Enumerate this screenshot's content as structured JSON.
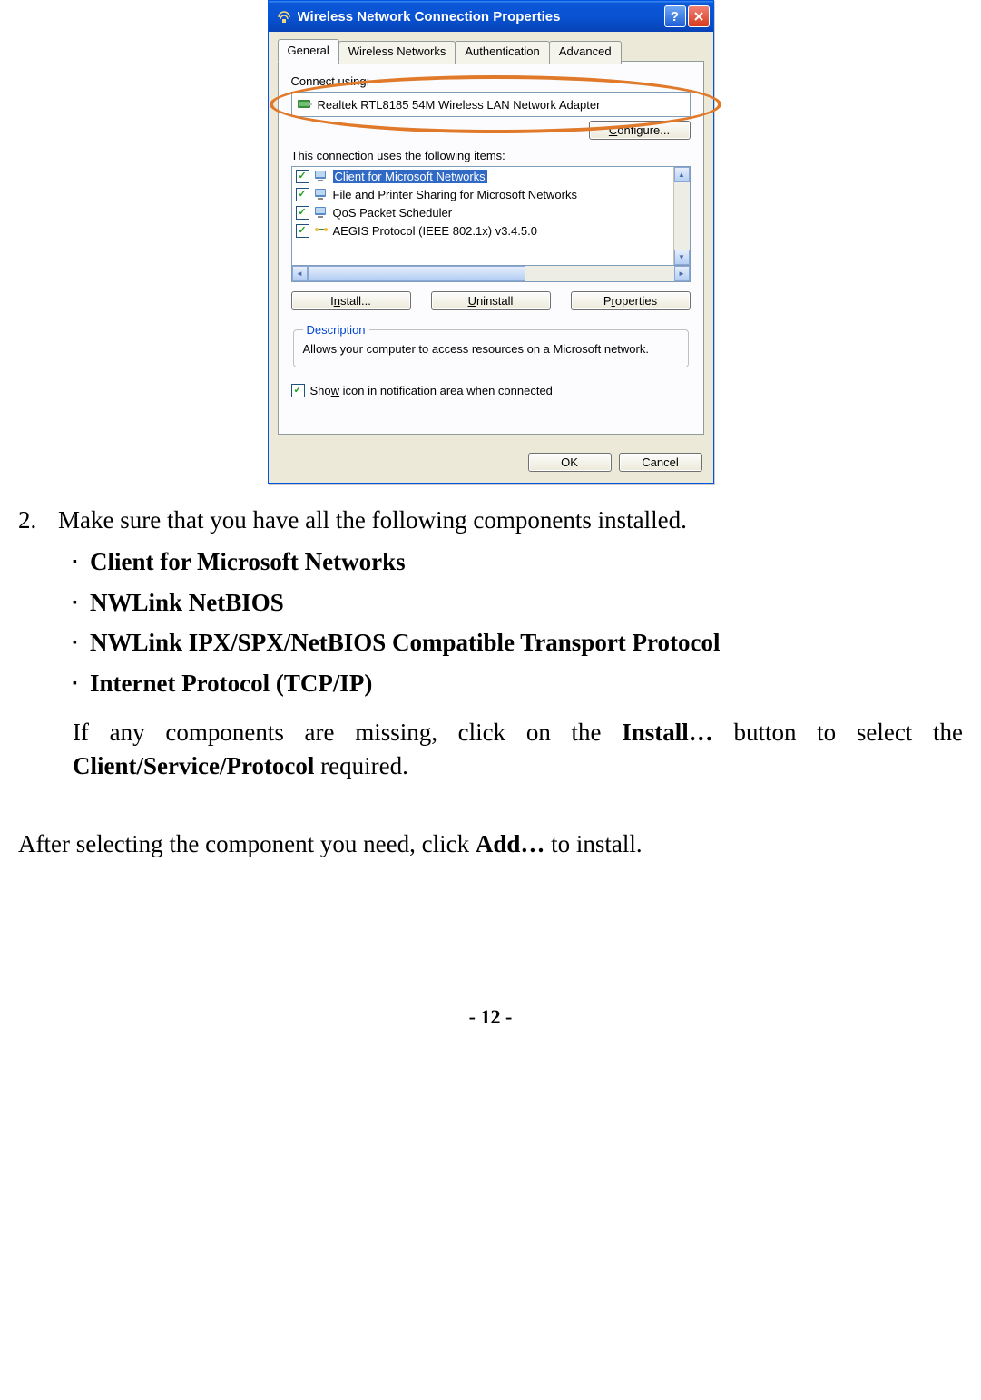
{
  "dialog": {
    "title": "Wireless Network Connection Properties",
    "tabs": [
      "General",
      "Wireless Networks",
      "Authentication",
      "Advanced"
    ],
    "active_tab": 0,
    "connect_using_label": "Connect using:",
    "adapter_name": "Realtek RTL8185 54M Wireless LAN Network Adapter",
    "configure_btn": "Configure...",
    "items_label": "This connection uses the following items:",
    "items": [
      {
        "checked": true,
        "icon": "client",
        "label": "Client for Microsoft Networks",
        "selected": true
      },
      {
        "checked": true,
        "icon": "service",
        "label": "File and Printer Sharing for Microsoft Networks",
        "selected": false
      },
      {
        "checked": true,
        "icon": "service",
        "label": "QoS Packet Scheduler",
        "selected": false
      },
      {
        "checked": true,
        "icon": "protocol",
        "label": "AEGIS Protocol (IEEE 802.1x) v3.4.5.0",
        "selected": false
      }
    ],
    "install_btn": "Install...",
    "uninstall_btn": "Uninstall",
    "properties_btn": "Properties",
    "description_legend": "Description",
    "description_text": "Allows your computer to access resources on a Microsoft network.",
    "show_icon_label": "Show icon in notification area when connected",
    "show_icon_checked": true,
    "ok_btn": "OK",
    "cancel_btn": "Cancel"
  },
  "doc": {
    "step_number": "2.",
    "step_text": "Make sure that you have all the following components installed.",
    "bullets": [
      "Client for Microsoft Networks",
      "NWLink NetBIOS",
      "NWLink IPX/SPX/NetBIOS Compatible Transport Protocol",
      "Internet Protocol (TCP/IP)"
    ],
    "para1_a": "If any components are missing, click on the ",
    "para1_b": "Install…",
    "para1_c": " button to select the ",
    "para1_d": "Client/Service/Protocol",
    "para1_e": " required.",
    "para2_a": "After selecting the component you need, click ",
    "para2_b": "Add…",
    "para2_c": " to install.",
    "page_prefix": "- ",
    "page_number": "12",
    "page_suffix": " -"
  }
}
